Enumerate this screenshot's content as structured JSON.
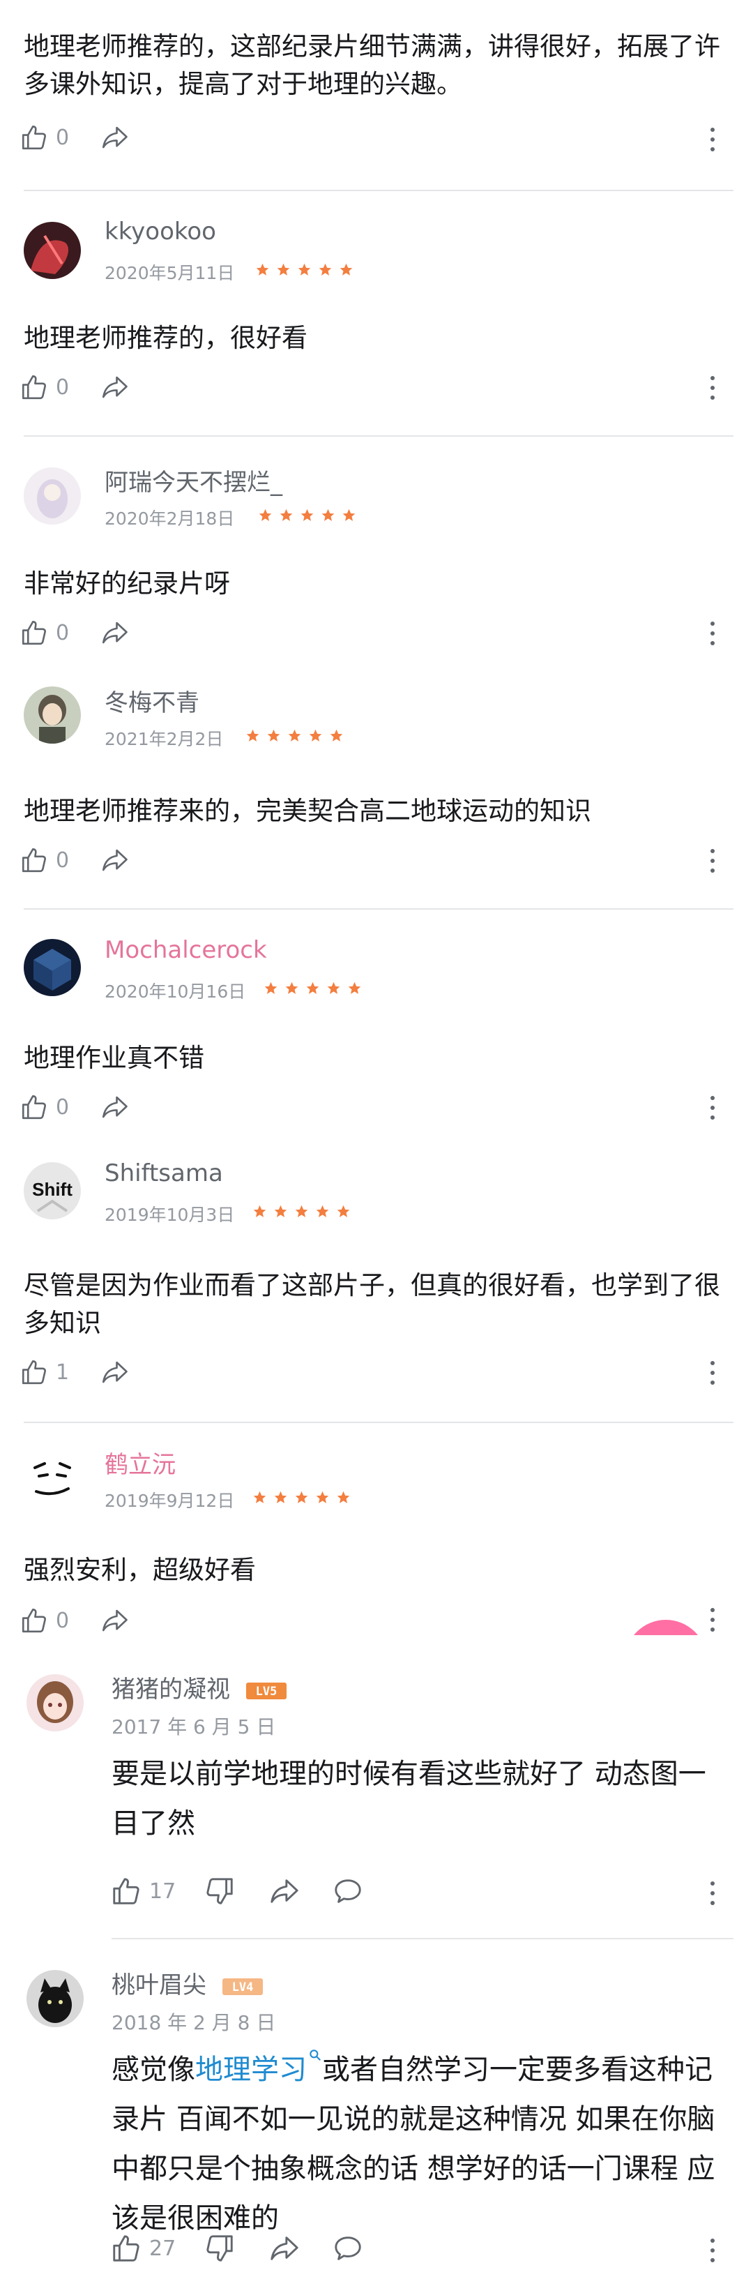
{
  "reviews": [
    {
      "text": "地理老师推荐的，这部纪录片细节满满，讲得很好，拓展了许多课外知识，提高了对于地理的兴趣。",
      "likes": "0"
    },
    {
      "username": "kkyookoo",
      "date": "2020年5月11日",
      "rating": 5,
      "text": "地理老师推荐的，很好看",
      "likes": "0"
    },
    {
      "username": "阿瑞今天不摆烂_",
      "date": "2020年2月18日",
      "rating": 5,
      "text": "非常好的纪录片呀",
      "likes": "0"
    },
    {
      "username": "冬梅不青",
      "date": "2021年2月2日",
      "rating": 5,
      "text": "地理老师推荐来的，完美契合高二地球运动的知识",
      "likes": "0"
    },
    {
      "username": "Mochalcerock",
      "date": "2020年10月16日",
      "rating": 5,
      "text": "地理作业真不错",
      "likes": "0"
    },
    {
      "username": "Shiftsama",
      "date": "2019年10月3日",
      "rating": 5,
      "text": "尽管是因为作业而看了这部片子，但真的很好看，也学到了很多知识",
      "likes": "1",
      "avatar_text": "Shift"
    },
    {
      "username": "鹤立沅",
      "date": "2019年9月12日",
      "rating": 5,
      "text": "强烈安利，超级好看",
      "likes": "0"
    }
  ],
  "comments": [
    {
      "username": "猪猪的凝视",
      "level": "LV5",
      "date": "2017 年 6 月 5 日",
      "text": "要是以前学地理的时候有看这些就好了 动态图一目了然",
      "likes": "17"
    },
    {
      "username": "桃叶眉尖",
      "level": "LV4",
      "date": "2018 年 2 月 8 日",
      "text_before": "感觉像",
      "link": "地理学习",
      "text_after": "或者自然学习一定要多看这种记录片 百闻不如一见说的就是这种情况 如果在你脑中都只是个抽象概念的话 想学好的话一门课程 应该是很困难的",
      "likes": "27"
    }
  ],
  "colors": {
    "star": "#f37e3f",
    "pink_name": "#e5749a",
    "link": "#1f8bd0",
    "lv5": "#f08a3c",
    "lv4": "#f5b784",
    "fab": "#ff6fa4"
  },
  "icons": [
    "thumb-up-icon",
    "share-icon",
    "more-vertical-icon",
    "star-icon",
    "thumb-down-icon",
    "reply-icon",
    "search-icon"
  ]
}
